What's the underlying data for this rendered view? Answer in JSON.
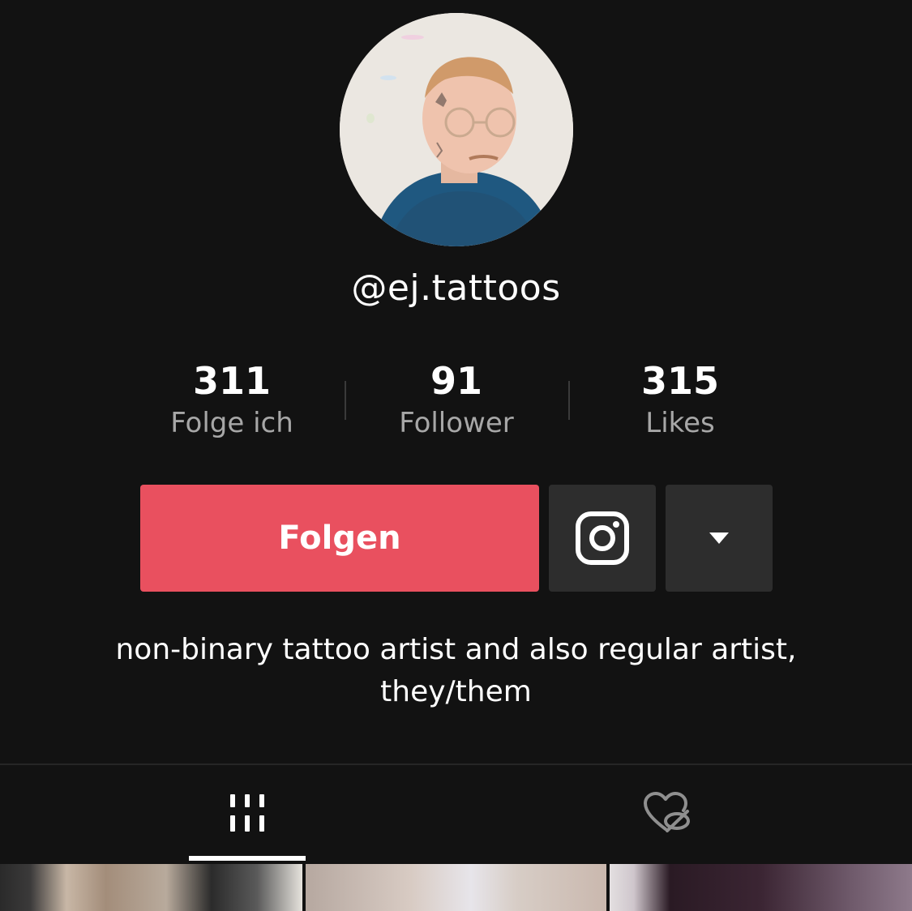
{
  "profile": {
    "username": "@ej.tattoos",
    "avatar_icon": "profile-photo"
  },
  "stats": [
    {
      "value": "311",
      "label": "Folge ich"
    },
    {
      "value": "91",
      "label": "Follower"
    },
    {
      "value": "315",
      "label": "Likes"
    }
  ],
  "actions": {
    "follow_label": "Folgen",
    "follow_color": "#e9505f",
    "instagram_icon": "instagram-icon",
    "more_icon": "caret-down-icon"
  },
  "bio": {
    "line1": "non-binary tattoo artist and also regular artist,",
    "line2": "they/them"
  },
  "tabs": [
    {
      "name": "videos",
      "icon": "grid-bars-icon",
      "active": true
    },
    {
      "name": "liked",
      "icon": "heart-hidden-icon",
      "active": false
    }
  ],
  "theme": {
    "background": "#121212",
    "secondary_text": "#a7a7a7",
    "button_dark": "#2d2d2d"
  }
}
